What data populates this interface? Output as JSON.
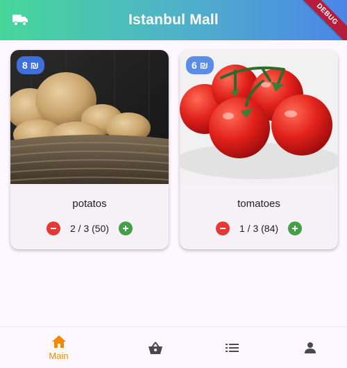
{
  "appbar": {
    "title": "Istanbul Mall",
    "left_icon": "truck-icon",
    "right_icon": "settings-icon",
    "debug_label": "DEBUG"
  },
  "products": [
    {
      "name": "potatos",
      "price": "8 ₪",
      "quantity": "2 / 3 (50)",
      "image": "potatoes-in-basket"
    },
    {
      "name": "tomatoes",
      "price": "6 ₪",
      "quantity": "1 / 3 (84)",
      "image": "tomatoes-on-vine"
    }
  ],
  "bottom_nav": {
    "items": [
      {
        "icon": "home-icon",
        "label": "Main",
        "active": true
      },
      {
        "icon": "basket-icon",
        "label": ""
      },
      {
        "icon": "list-icon",
        "label": ""
      },
      {
        "icon": "person-icon",
        "label": ""
      }
    ]
  },
  "colors": {
    "accent": "#f08a00",
    "badge": "#3f6fd8",
    "minus": "#e53935",
    "plus": "#43a047",
    "debug": "#b71c3b"
  }
}
